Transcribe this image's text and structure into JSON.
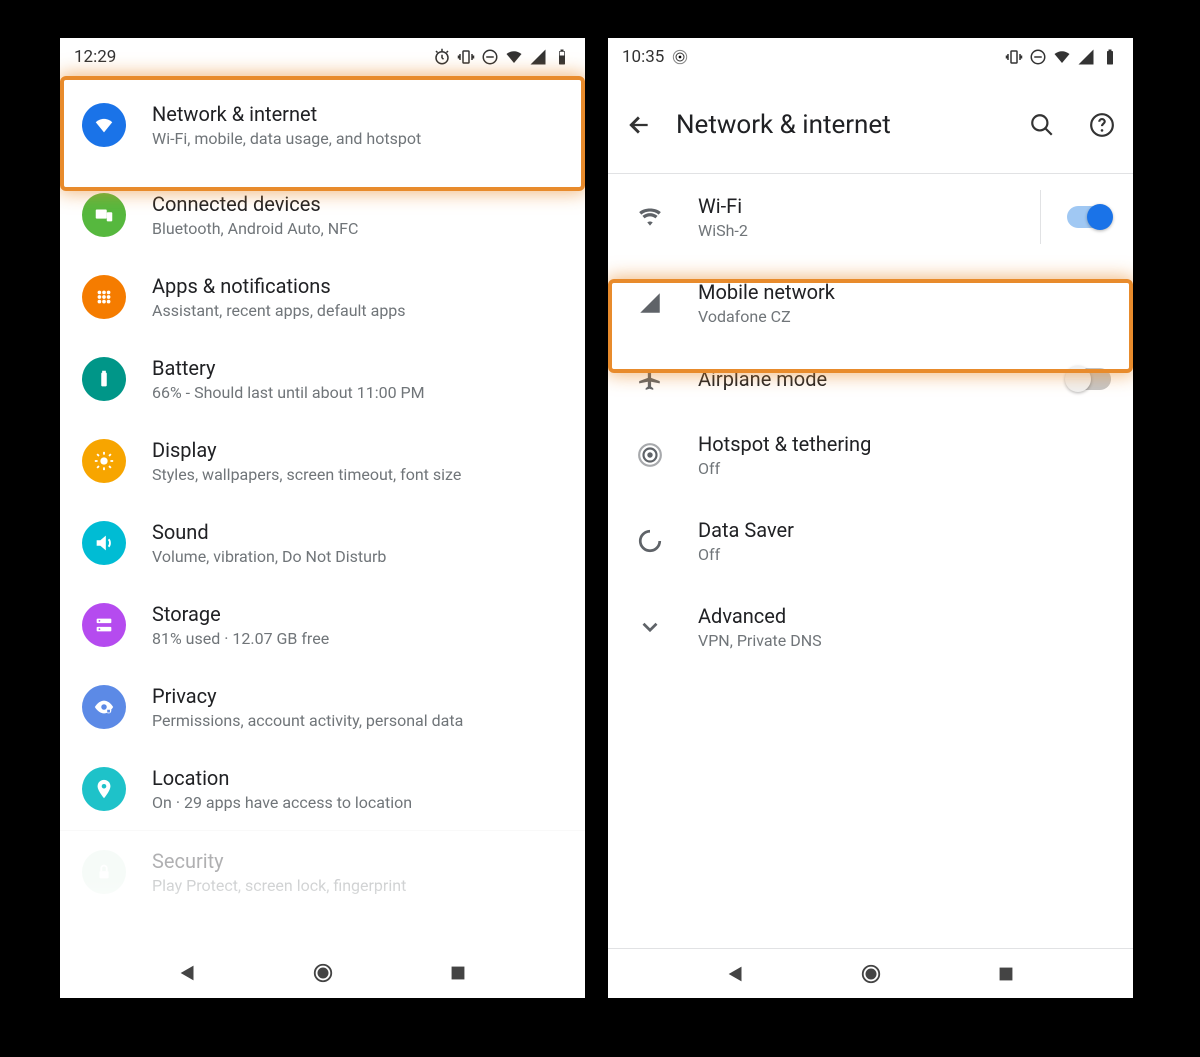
{
  "left": {
    "status": {
      "time": "12:29"
    },
    "items": [
      {
        "title": "Network & internet",
        "sub": "Wi-Fi, mobile, data usage, and hotspot"
      },
      {
        "title": "Connected devices",
        "sub": "Bluetooth, Android Auto, NFC"
      },
      {
        "title": "Apps & notifications",
        "sub": "Assistant, recent apps, default apps"
      },
      {
        "title": "Battery",
        "sub": "66% - Should last until about 11:00 PM"
      },
      {
        "title": "Display",
        "sub": "Styles, wallpapers, screen timeout, font size"
      },
      {
        "title": "Sound",
        "sub": "Volume, vibration, Do Not Disturb"
      },
      {
        "title": "Storage",
        "sub": "81% used · 12.07 GB free"
      },
      {
        "title": "Privacy",
        "sub": "Permissions, account activity, personal data"
      },
      {
        "title": "Location",
        "sub": "On · 29 apps have access to location"
      },
      {
        "title": "Security",
        "sub": "Play Protect, screen lock, fingerprint"
      }
    ]
  },
  "right": {
    "status": {
      "time": "10:35"
    },
    "header": {
      "title": "Network & internet"
    },
    "items": [
      {
        "title": "Wi-Fi",
        "sub": "WiSh-2",
        "toggle": "on"
      },
      {
        "title": "Mobile network",
        "sub": "Vodafone CZ"
      },
      {
        "title": "Airplane mode",
        "sub": "",
        "toggle": "off"
      },
      {
        "title": "Hotspot & tethering",
        "sub": "Off"
      },
      {
        "title": "Data Saver",
        "sub": "Off"
      },
      {
        "title": "Advanced",
        "sub": "VPN, Private DNS"
      }
    ]
  },
  "highlight_color": "#e88b2c"
}
